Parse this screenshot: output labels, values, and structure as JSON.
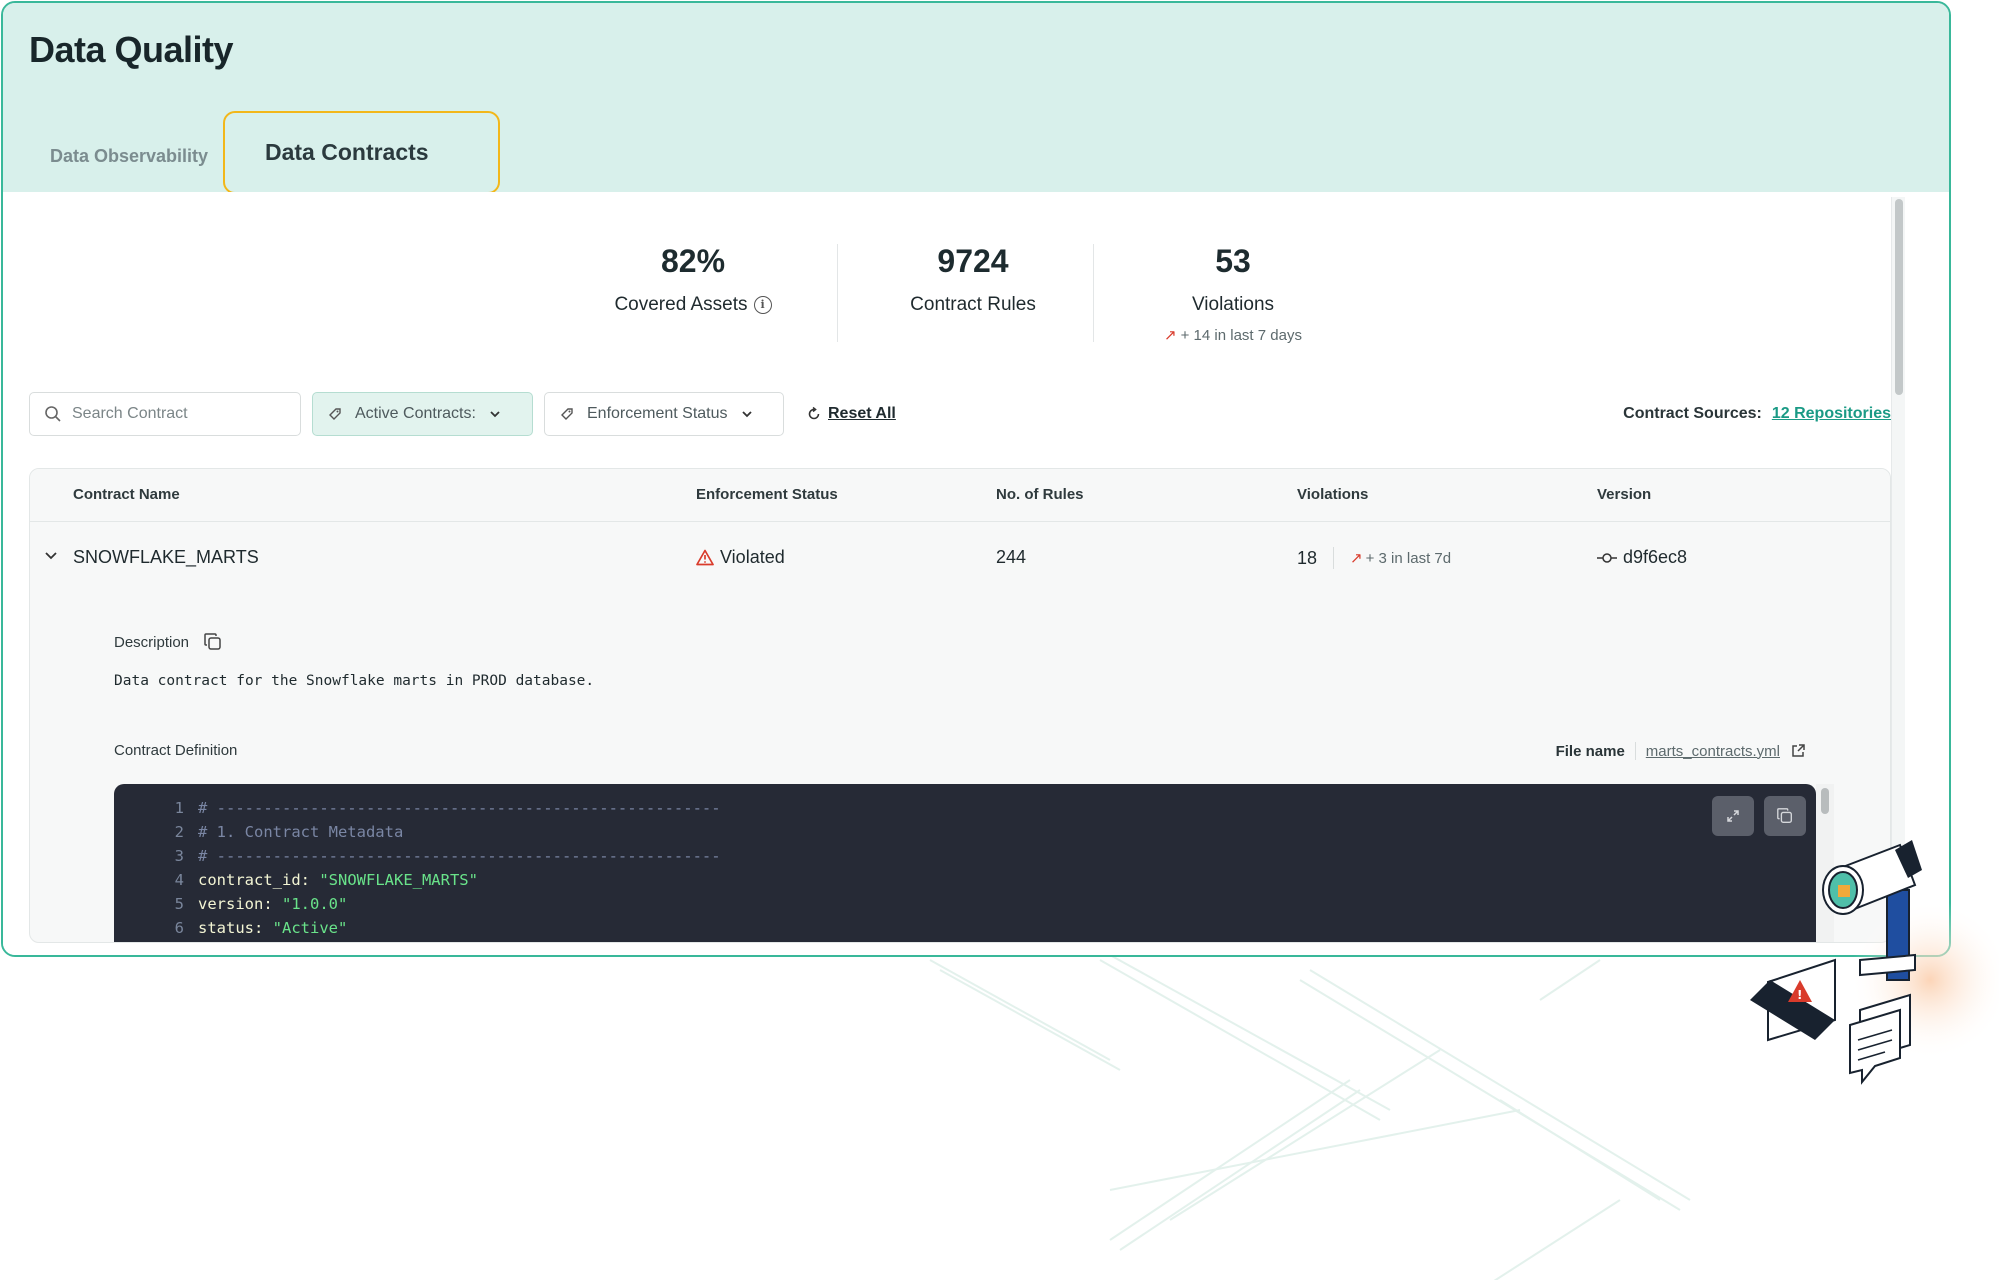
{
  "page": {
    "title": "Data Quality"
  },
  "tabs": [
    {
      "label": "Data Observability",
      "active": false
    },
    {
      "label": "Data Contracts",
      "active": true
    }
  ],
  "stats": [
    {
      "value": "82%",
      "label": "Covered Assets",
      "has_info": true
    },
    {
      "value": "9724",
      "label": "Contract Rules"
    },
    {
      "value": "53",
      "label": "Violations",
      "trend": "+ 14 in last 7 days"
    }
  ],
  "filters": {
    "search_placeholder": "Search Contract",
    "active_contracts": "Active Contracts:",
    "enforcement_status": "Enforcement Status",
    "reset": "Reset All",
    "sources_label": "Contract Sources:",
    "sources_value": "12 Repositories"
  },
  "table": {
    "columns": [
      "Contract Name",
      "Enforcement Status",
      "No. of Rules",
      "Violations",
      "Version"
    ],
    "rows": [
      {
        "name": "SNOWFLAKE_MARTS",
        "status": "Violated",
        "rules": "244",
        "violations": "18",
        "violations_trend": "+ 3 in last 7d",
        "version": "d9f6ec8"
      }
    ],
    "detail": {
      "description_label": "Description",
      "description": "Data contract for the Snowflake marts in PROD database.",
      "definition_label": "Contract Definition",
      "file_label": "File name",
      "file_name": "marts_contracts.yml",
      "code": [
        {
          "n": "1",
          "kind": "comment",
          "text": "# ------------------------------------------------------"
        },
        {
          "n": "2",
          "kind": "comment",
          "text": "# 1. Contract Metadata"
        },
        {
          "n": "3",
          "kind": "comment",
          "text": "# ------------------------------------------------------"
        },
        {
          "n": "4",
          "kind": "kv",
          "key": "contract_id:",
          "value": "\"SNOWFLAKE_MARTS\""
        },
        {
          "n": "5",
          "kind": "kv",
          "key": "version:",
          "value": "\"1.0.0\""
        },
        {
          "n": "6",
          "kind": "kv",
          "key": "status:",
          "value": "\"Active\""
        }
      ]
    }
  },
  "colors": {
    "accent": "#39b89a",
    "header_bg": "#d8f0eb",
    "active_tab_border": "#f2b71a",
    "violation": "#d93b2b",
    "code_bg": "#262a36"
  }
}
